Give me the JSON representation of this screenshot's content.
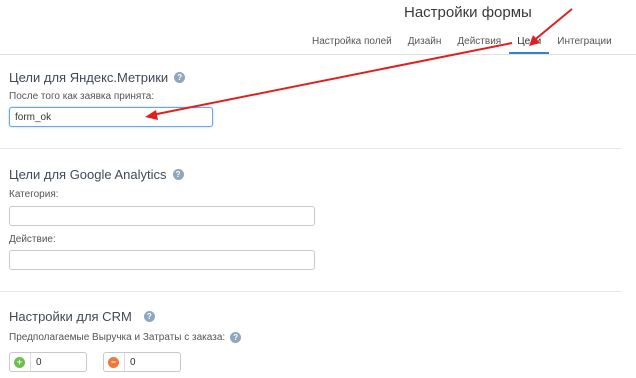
{
  "header": {
    "title": "Настройки формы"
  },
  "tabs": [
    {
      "label": "Настройка полей",
      "active": false
    },
    {
      "label": "Дизайн",
      "active": false
    },
    {
      "label": "Действия",
      "active": false
    },
    {
      "label": "Цели",
      "active": true
    },
    {
      "label": "Интеграции",
      "active": false
    }
  ],
  "yandex": {
    "title": "Цели для Яндекс.Метрики",
    "field_label": "После того как заявка принята:",
    "field_value": "form_ok"
  },
  "google": {
    "title": "Цели для Google Analytics",
    "category_label": "Категория:",
    "category_value": "",
    "action_label": "Действие:",
    "action_value": ""
  },
  "crm": {
    "title": "Настройки для CRM",
    "field_label": "Предполагаемые Выручка и Затраты с заказа:",
    "revenue_value": "0",
    "cost_value": "0"
  },
  "colors": {
    "accent": "#3b82c4",
    "annotation_arrow": "#e02020",
    "plus_icon": "#6cc04a",
    "minus_icon": "#f0783c",
    "help_icon": "#8fa6c0"
  },
  "icons": {
    "help": "question-circle-icon",
    "plus": "plus-circle-icon",
    "minus": "minus-circle-icon"
  }
}
